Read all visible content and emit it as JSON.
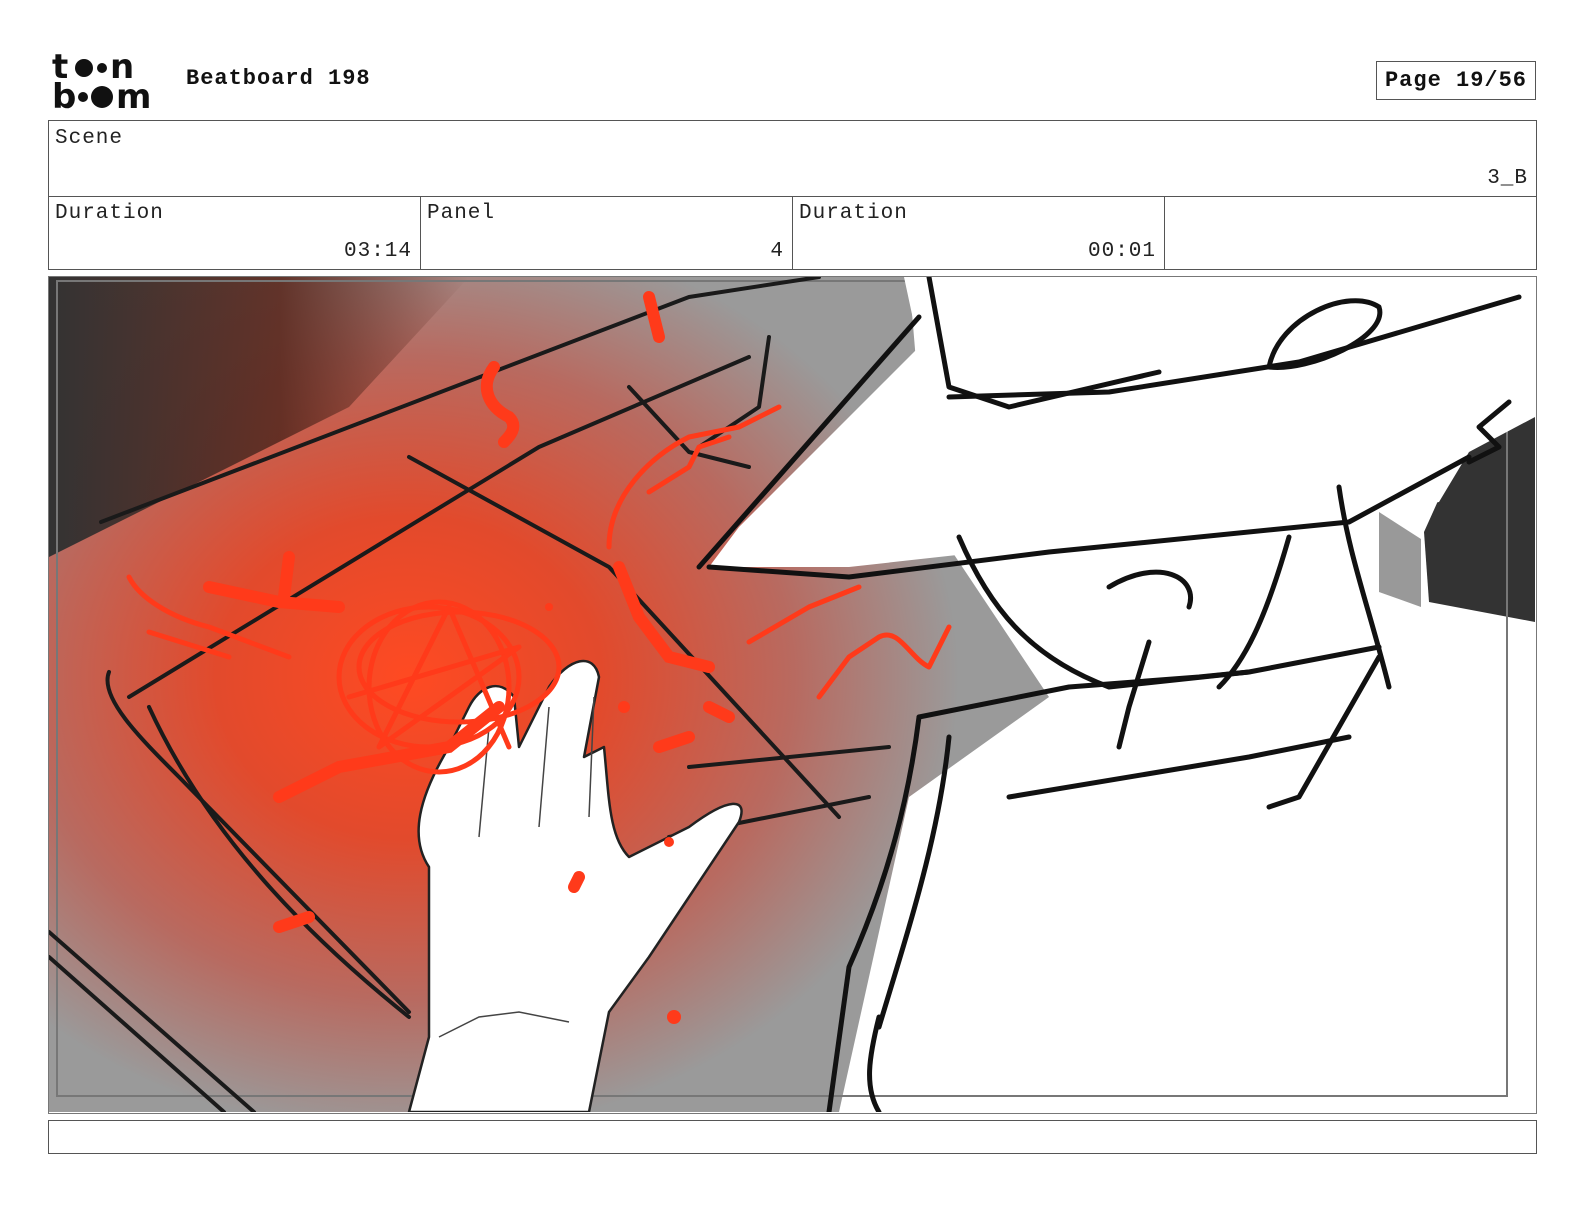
{
  "header": {
    "logo_text_top": "toon",
    "logo_text_bottom": "boom",
    "title": "Beatboard 198",
    "page": "Page 19/56"
  },
  "scene": {
    "label": "Scene",
    "value": "3_B"
  },
  "cells": [
    {
      "label": "Duration",
      "value": "03:14"
    },
    {
      "label": "Panel",
      "value": "4"
    },
    {
      "label": "Duration",
      "value": "00:01"
    },
    {
      "label": "",
      "value": ""
    }
  ],
  "colors": {
    "accent_red": "#ff3a1a",
    "dark_gray": "#333333",
    "mid_gray": "#9a9a9a"
  }
}
